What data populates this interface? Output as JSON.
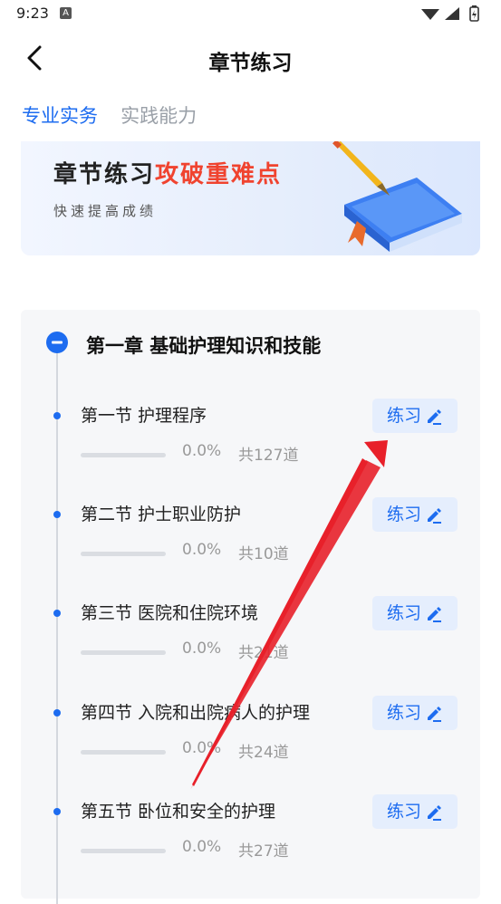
{
  "status_bar": {
    "time": "9:23",
    "notification_icon": "A"
  },
  "header": {
    "title": "章节练习"
  },
  "tabs": [
    {
      "label": "专业实务",
      "active": true
    },
    {
      "label": "实践能力",
      "active": false
    }
  ],
  "banner": {
    "title_black": "章节练习",
    "title_red": "攻破重难点",
    "subtitle": "快速提高成绩"
  },
  "chapter": {
    "title": "第一章 基础护理知识和技能",
    "icon": "collapse-icon",
    "sections": [
      {
        "title": "第一节 护理程序",
        "progress": "0.0%",
        "progress_value": 0,
        "count": "共127道",
        "button": "练习"
      },
      {
        "title": "第二节 护士职业防护",
        "progress": "0.0%",
        "progress_value": 0,
        "count": "共10道",
        "button": "练习"
      },
      {
        "title": "第三节 医院和住院环境",
        "progress": "0.0%",
        "progress_value": 0,
        "count": "共21道",
        "button": "练习"
      },
      {
        "title": "第四节 入院和出院病人的护理",
        "progress": "0.0%",
        "progress_value": 0,
        "count": "共24道",
        "button": "练习"
      },
      {
        "title": "第五节 卧位和安全的护理",
        "progress": "0.0%",
        "progress_value": 0,
        "count": "共27道",
        "button": "练习"
      }
    ]
  },
  "colors": {
    "accent": "#1d6cf0",
    "highlight_red": "#f0432f",
    "annotation_arrow": "#e8202a"
  }
}
